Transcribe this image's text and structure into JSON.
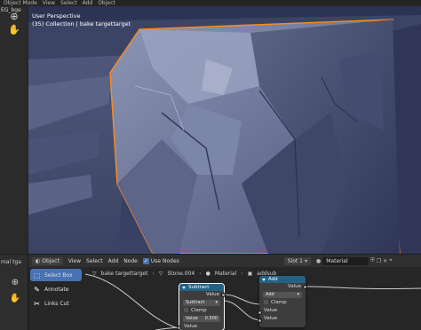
{
  "viewport": {
    "toolbar_items": [
      "Object Mode",
      "View",
      "Select",
      "Add",
      "Object"
    ],
    "left_label": "EG_bge",
    "overlay_title": "User Perspective",
    "overlay_subtitle": "(35) Collection | bake targettarget",
    "tools": [
      "cursor-icon",
      "hand-icon"
    ]
  },
  "node_editor": {
    "tab_label": "mal tga",
    "header": {
      "editor_type": "Object",
      "menus": [
        "View",
        "Select",
        "Add",
        "Node"
      ],
      "use_nodes_label": "Use Nodes",
      "slot": "Slot 1",
      "material": "Material"
    },
    "tools": [
      {
        "label": "Select Box",
        "active": true,
        "icon": "select-box-icon"
      },
      {
        "label": "Annotate",
        "active": false,
        "icon": "annotate-icon"
      },
      {
        "label": "Links Cut",
        "active": false,
        "icon": "links-cut-icon"
      }
    ],
    "breadcrumb": [
      "bake targettarget",
      "Stone.004",
      "Material",
      "addsub"
    ],
    "nodes": {
      "subtract": {
        "title": "Subtract",
        "output": "Value",
        "operation": "Subtract",
        "clamp": "Clamp",
        "value_label": "Value",
        "value": "0.500",
        "input": "Value"
      },
      "add": {
        "title": "Add",
        "output": "Value",
        "operation": "Add",
        "clamp": "Clamp",
        "inputs": [
          "Value",
          "Value"
        ]
      }
    }
  },
  "colors": {
    "accent": "#4772b3",
    "node_header": "#246283",
    "selection_outline": "#ff8a1e"
  }
}
